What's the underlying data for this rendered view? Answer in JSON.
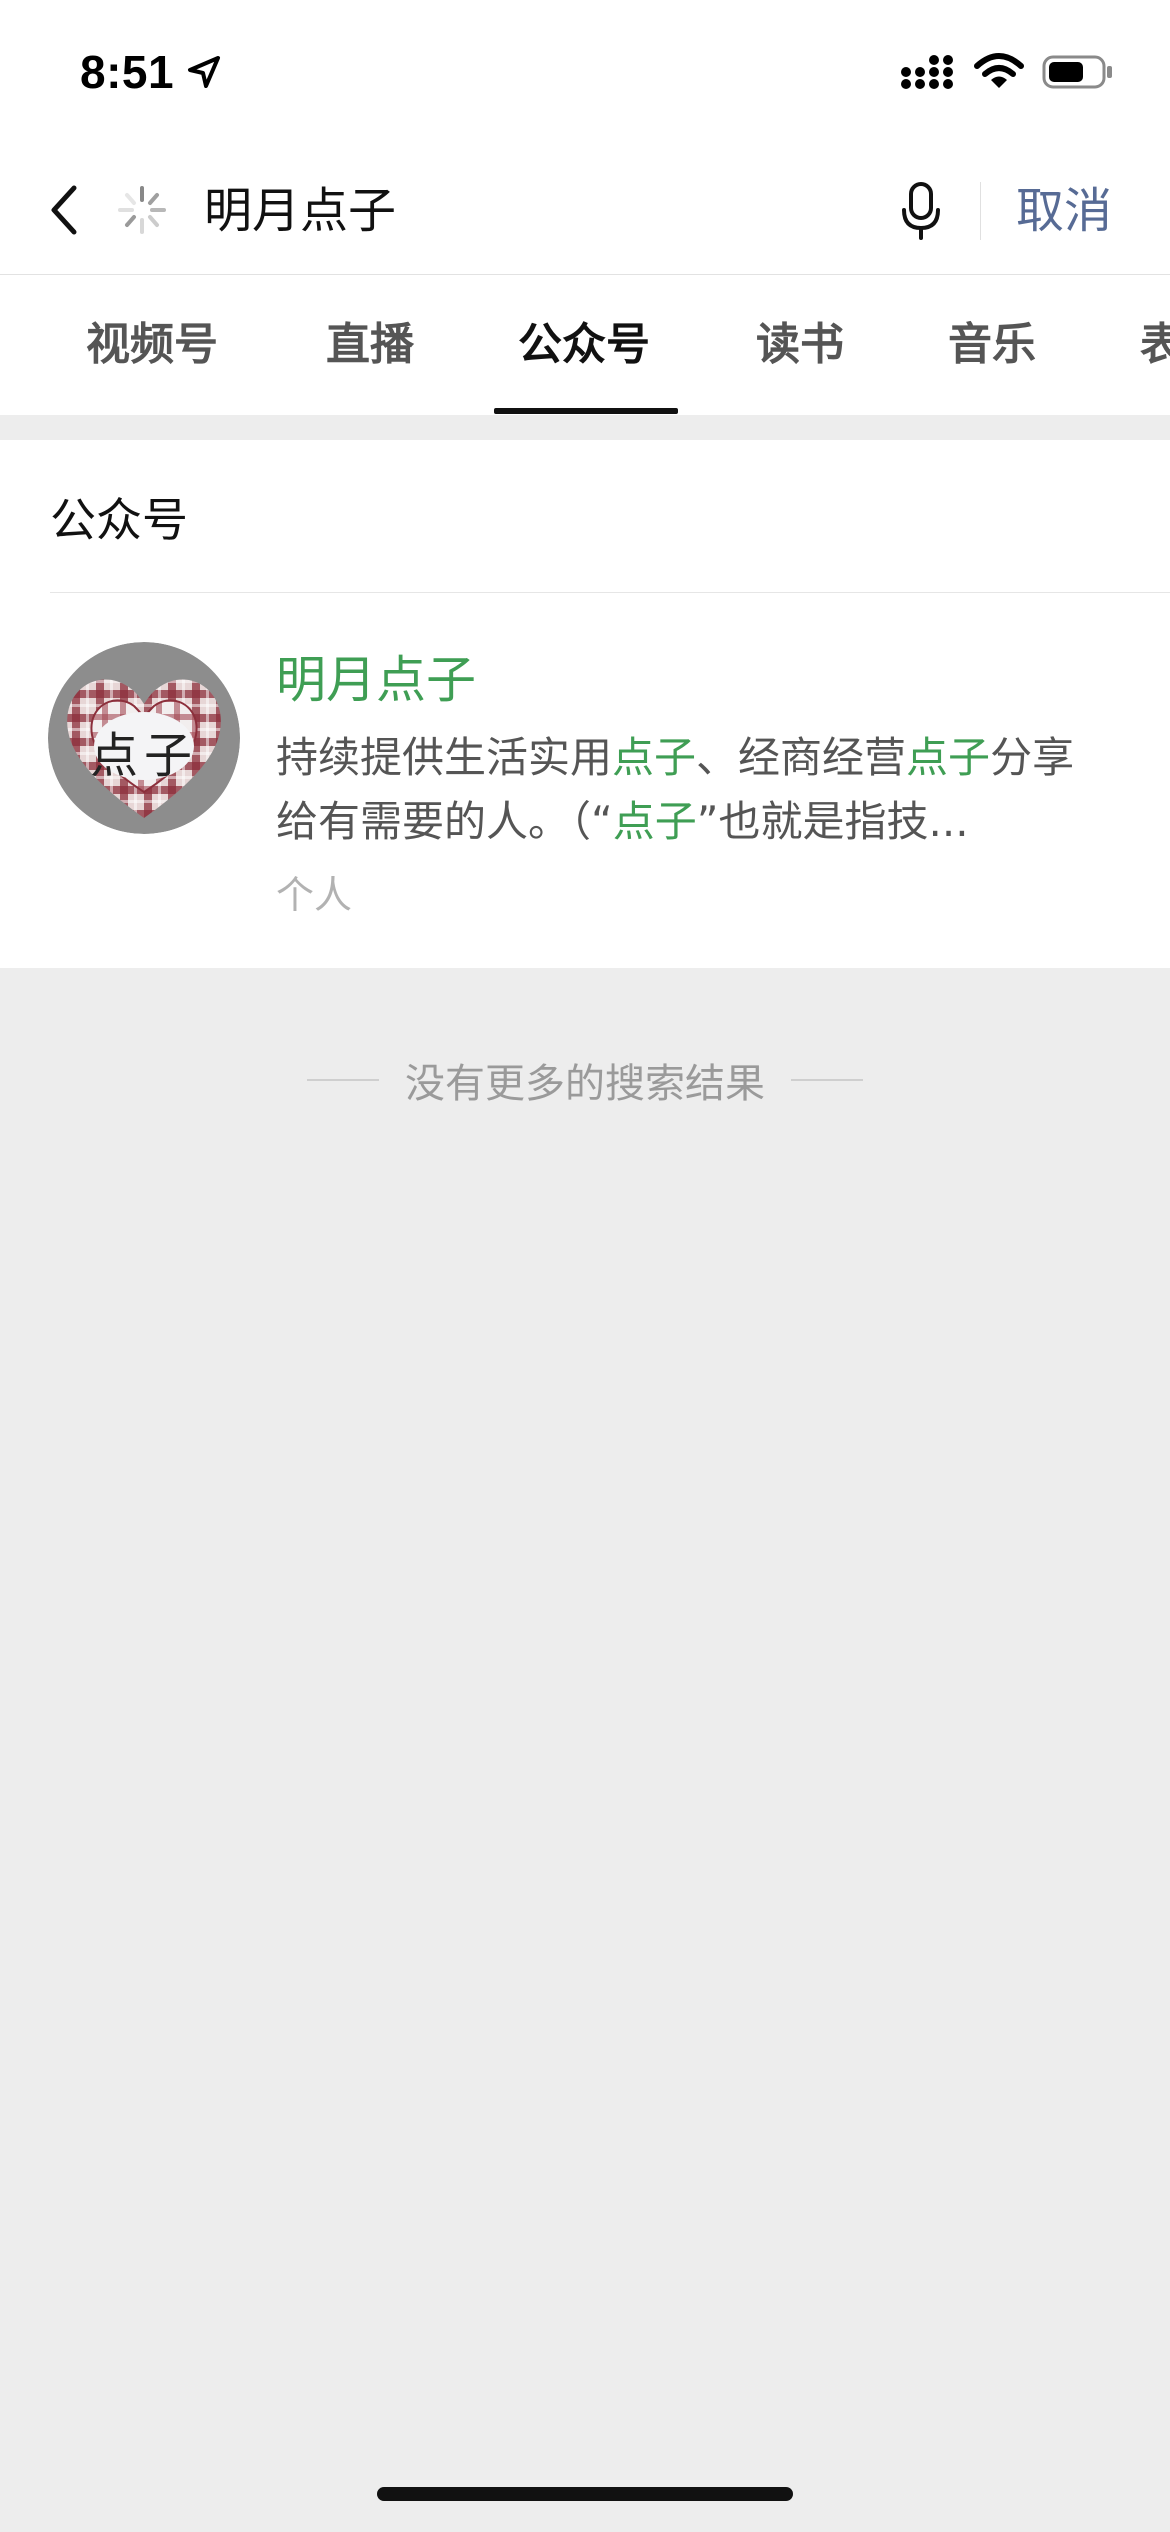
{
  "status_bar": {
    "time": "8:51",
    "icons": [
      "location-arrow-icon",
      "cellular-signal-icon",
      "wifi-icon",
      "battery-icon"
    ]
  },
  "search": {
    "query": "明月点子",
    "cancel_label": "取消",
    "icons": [
      "back-chevron-icon",
      "loading-spinner-icon",
      "microphone-icon"
    ]
  },
  "tabs": [
    {
      "label": "视频号"
    },
    {
      "label": "直播"
    },
    {
      "label": "公众号",
      "active": true
    },
    {
      "label": "读书"
    },
    {
      "label": "音乐"
    },
    {
      "label": "表情"
    }
  ],
  "results": {
    "section_title": "公众号",
    "items": [
      {
        "name": "明月点子",
        "avatar_text": "点子",
        "description_parts": [
          {
            "text": "持续提供生活实用"
          },
          {
            "text": "点子",
            "highlight": true
          },
          {
            "text": "、经商经营"
          },
          {
            "text": "点子",
            "highlight": true
          },
          {
            "text": "分享给有需要的人。（“"
          },
          {
            "text": "点子",
            "highlight": true
          },
          {
            "text": "”也就是指技..."
          }
        ],
        "type": "个人"
      }
    ],
    "no_more_text": "没有更多的搜索结果"
  },
  "colors": {
    "accent_green": "#3f9e54",
    "link_blue": "#576b95",
    "background": "#ededed"
  }
}
